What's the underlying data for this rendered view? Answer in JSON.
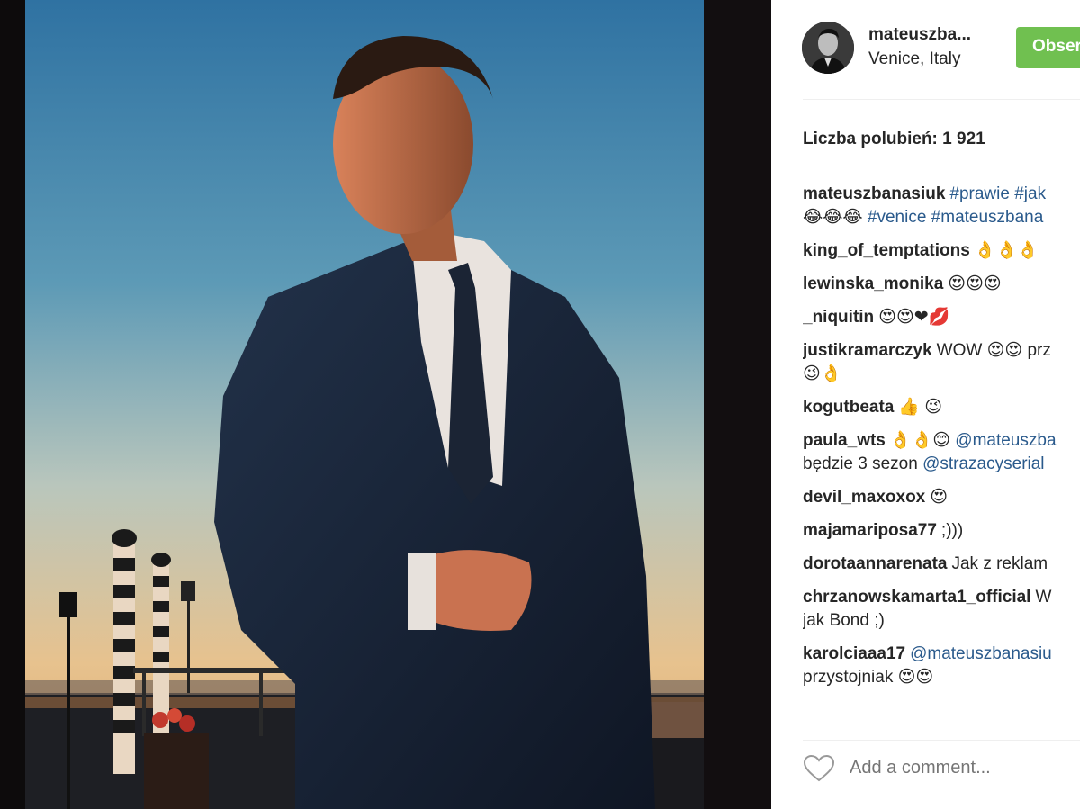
{
  "post": {
    "username": "mateuszba...",
    "location": "Venice, Italy",
    "follow_label": "Obserwuj",
    "likes_label": "Liczba polubień: 1 921",
    "add_comment_placeholder": "Add a comment..."
  },
  "comments": [
    {
      "user": "mateuszbanasiuk",
      "parts": [
        {
          "t": "#prawie",
          "tag": true
        },
        {
          "t": " ",
          "tag": false
        },
        {
          "t": "#jak",
          "tag": true
        }
      ],
      "line2": [
        {
          "t": "😂😂😂 ",
          "tag": false
        },
        {
          "t": "#venice",
          "tag": true
        },
        {
          "t": " ",
          "tag": false
        },
        {
          "t": "#mateuszbana",
          "tag": true
        }
      ]
    },
    {
      "user": "king_of_temptations",
      "text": "👌👌👌"
    },
    {
      "user": "lewinska_monika",
      "text": "😍😍😍"
    },
    {
      "user": "_niquitin",
      "text": "😍😍❤💋"
    },
    {
      "user": "justikramarczyk",
      "text": "WOW 😍😍 prz",
      "line2text": "😉👌"
    },
    {
      "user": "kogutbeata",
      "text": "👍 😉"
    },
    {
      "user": "paula_wts",
      "parts": [
        {
          "t": "👌👌😊 ",
          "tag": false
        },
        {
          "t": "@mateuszba",
          "tag": true
        }
      ],
      "line2": [
        {
          "t": "będzie 3 sezon ",
          "tag": false
        },
        {
          "t": "@strazacyserial",
          "tag": true
        }
      ]
    },
    {
      "user": "devil_maxoxox",
      "text": "😍"
    },
    {
      "user": "majamariposa77",
      "text": ";)))"
    },
    {
      "user": "dorotaannarenata",
      "text": "Jak z reklam"
    },
    {
      "user": "chrzanowskamarta1_official",
      "text": "W",
      "line2text": "jak Bond ;)"
    },
    {
      "user": "karolciaaa17",
      "parts": [
        {
          "t": "@mateuszbanasiu",
          "tag": true
        }
      ],
      "line2text": "przystojniak 😍😍"
    }
  ],
  "colors": {
    "follow_bg": "#70c050",
    "link": "#2a5a8c",
    "text": "#262626"
  },
  "icons": {
    "like": "heart-outline-icon"
  }
}
